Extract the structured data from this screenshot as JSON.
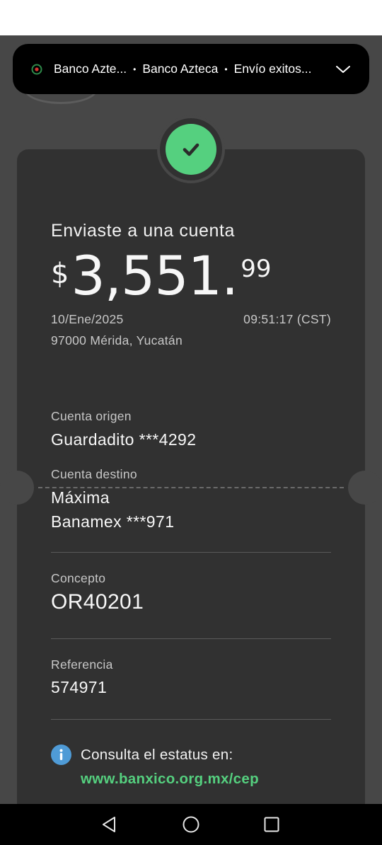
{
  "notification": {
    "icon": "banco-azteca-app-icon",
    "app_name": "Banco Azte...",
    "sender": "Banco Azteca",
    "title": "Envío exitos...",
    "separator": "•"
  },
  "receipt": {
    "status_icon": "check-icon",
    "headline": "Enviaste a una cuenta",
    "amount": {
      "currency": "$",
      "integer": "3,551.",
      "cents": "99"
    },
    "date": "10/Ene/2025",
    "time": "09:51:17 (CST)",
    "location": "97000 Mérida, Yucatán",
    "origin": {
      "label": "Cuenta origen",
      "value": "Guardadito ***4292"
    },
    "destination": {
      "label": "Cuenta destino",
      "name": "Máxima",
      "account": "Banamex ***971"
    },
    "concept": {
      "label": "Concepto",
      "value": "OR40201"
    },
    "reference": {
      "label": "Referencia",
      "value": "574971"
    },
    "info": {
      "text": "Consulta el estatus en:",
      "link": "www.banxico.org.mx/cep"
    }
  },
  "navbar": {
    "back_icon": "back-icon",
    "home_icon": "home-icon",
    "recents_icon": "recents-icon"
  },
  "colors": {
    "success": "#55d07f",
    "card": "#313131",
    "background": "#474747",
    "info": "#4f9bd6"
  }
}
